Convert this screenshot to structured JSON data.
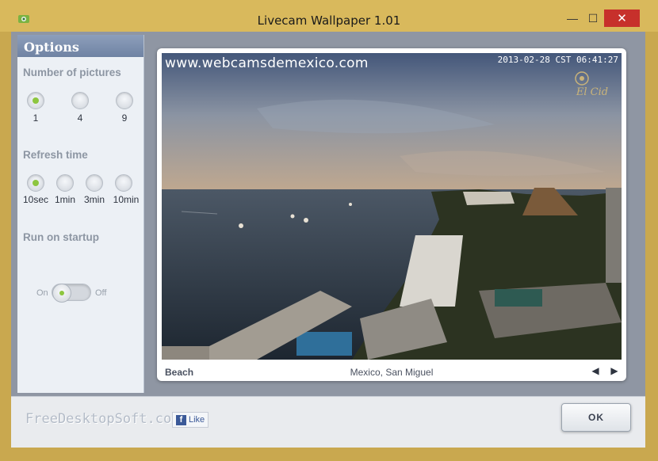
{
  "window": {
    "title": "Livecam Wallpaper 1.01"
  },
  "titlebar_buttons": {
    "minimize": "—",
    "maximize": "☐",
    "close": "✕"
  },
  "sidebar": {
    "header": "Options",
    "pictures": {
      "label": "Number of pictures",
      "options": [
        "1",
        "4",
        "9"
      ],
      "selected": "1"
    },
    "refresh": {
      "label": "Refresh time",
      "options": [
        "10sec",
        "1min",
        "3min",
        "10min"
      ],
      "selected": "10sec"
    },
    "startup": {
      "label": "Run on startup",
      "on_label": "On",
      "off_label": "Off",
      "state": "On"
    }
  },
  "viewer": {
    "watermark_url": "www.webcamsdemexico.com",
    "timestamp": "2013-02-28 CST 06:41:27",
    "logo_text": "El Cid",
    "caption_left": "Beach",
    "caption_center": "Mexico, San Miguel",
    "prev": "◀",
    "next": "▶"
  },
  "footer": {
    "brand": "FreeDesktopSoft.com",
    "like_label": "Like",
    "fb_glyph": "f",
    "ok_label": "OK"
  },
  "colors": {
    "accent_green": "#8dc63f",
    "window_frame": "#d9b95c",
    "close_red": "#c7302b"
  }
}
